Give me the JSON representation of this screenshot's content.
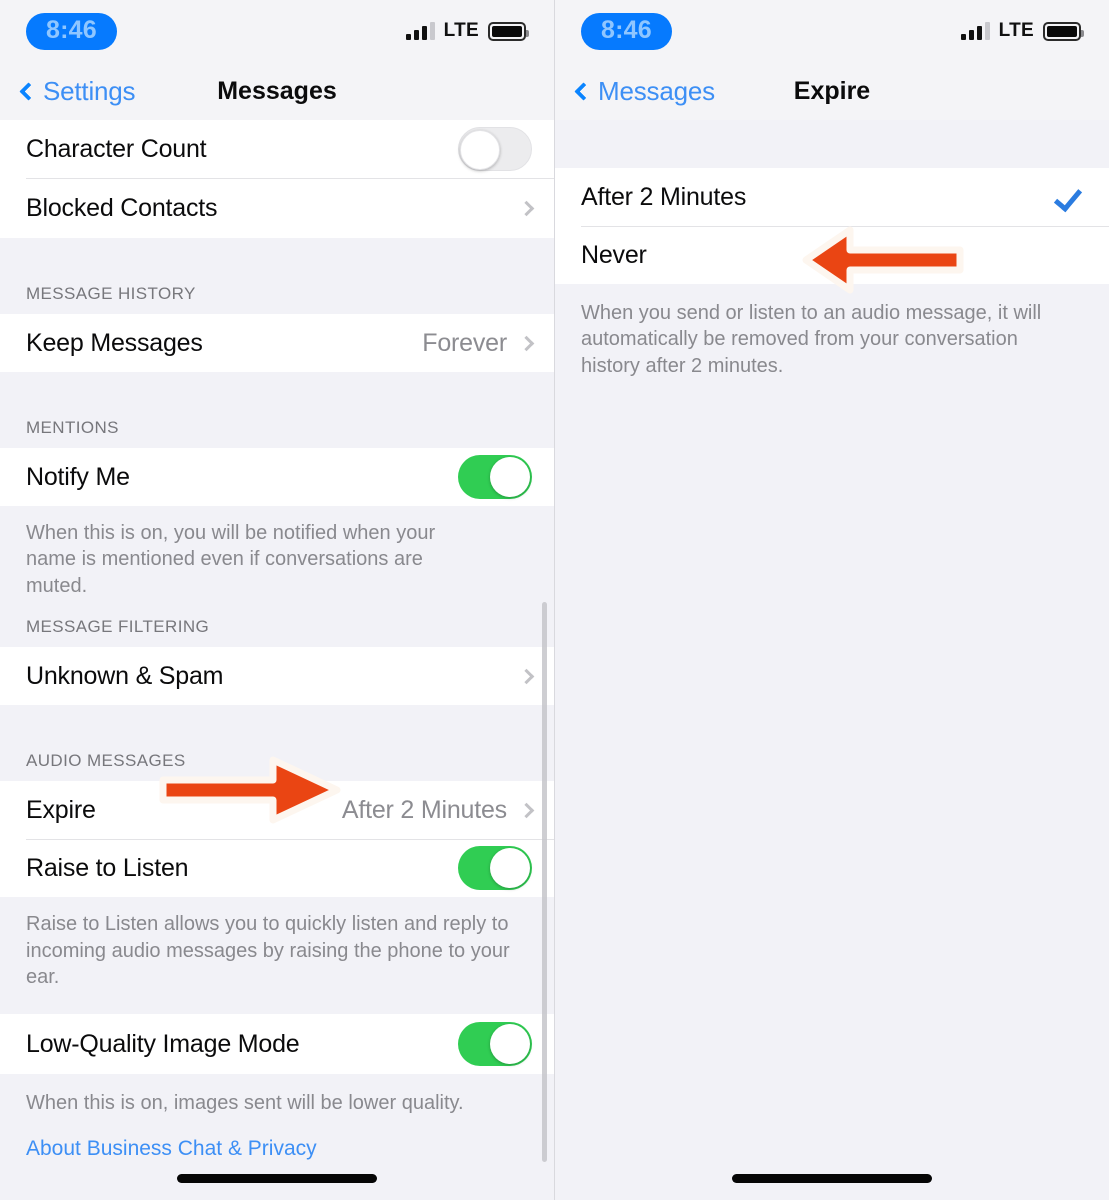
{
  "status_bar": {
    "time": "8:46",
    "carrier": "LTE",
    "signal_icon": "signal-bars-icon",
    "battery_icon": "battery-icon",
    "time_pill_color": "#067afe",
    "time_text_color": "#8fc6ff"
  },
  "left_screen": {
    "nav": {
      "back_label": "Settings",
      "title": "Messages",
      "back_icon": "chevron-left-icon",
      "accent_color": "#3d8ff5"
    },
    "rows": [
      {
        "label": "Character Count",
        "type": "toggle",
        "on": false
      },
      {
        "label": "Blocked Contacts",
        "type": "disclosure",
        "value": ""
      }
    ],
    "sections": [
      {
        "header": "MESSAGE HISTORY",
        "rows": [
          {
            "label": "Keep Messages",
            "type": "disclosure",
            "value": "Forever"
          }
        ],
        "footnote": ""
      },
      {
        "header": "MENTIONS",
        "rows": [
          {
            "label": "Notify Me",
            "type": "toggle",
            "on": true
          }
        ],
        "footnote": "When this is on, you will be notified when your name is mentioned even if conversations are muted."
      },
      {
        "header": "MESSAGE FILTERING",
        "rows": [
          {
            "label": "Unknown & Spam",
            "type": "disclosure",
            "value": ""
          }
        ],
        "footnote": ""
      },
      {
        "header": "AUDIO MESSAGES",
        "rows": [
          {
            "label": "Expire",
            "type": "disclosure",
            "value": "After 2 Minutes"
          },
          {
            "label": "Raise to Listen",
            "type": "toggle",
            "on": true
          }
        ],
        "footnote": "Raise to Listen allows you to quickly listen and reply to incoming audio messages by raising the phone to your ear."
      },
      {
        "header": "",
        "rows": [
          {
            "label": "Low-Quality Image Mode",
            "type": "toggle",
            "on": true
          }
        ],
        "footnote": "When this is on, images sent will be lower quality."
      }
    ],
    "link": "About Business Chat & Privacy"
  },
  "right_screen": {
    "nav": {
      "back_label": "Messages",
      "title": "Expire",
      "back_icon": "chevron-left-icon",
      "accent_color": "#3d8ff5"
    },
    "options": [
      {
        "label": "After 2 Minutes",
        "selected": true
      },
      {
        "label": "Never",
        "selected": false
      }
    ],
    "footnote": "When you send or listen to an audio message, it will automatically be removed from your conversation history after 2 minutes.",
    "checkmark_color": "#2b7ce0"
  },
  "annotations": {
    "arrow_color": "#ea4513",
    "arrow_outline_color": "#fdf6ef",
    "left_arrow": {
      "name": "annotation-arrow-right",
      "direction": "right",
      "target": "Expire row value"
    },
    "right_arrow": {
      "name": "annotation-arrow-left",
      "direction": "left",
      "target": "Never option"
    }
  }
}
